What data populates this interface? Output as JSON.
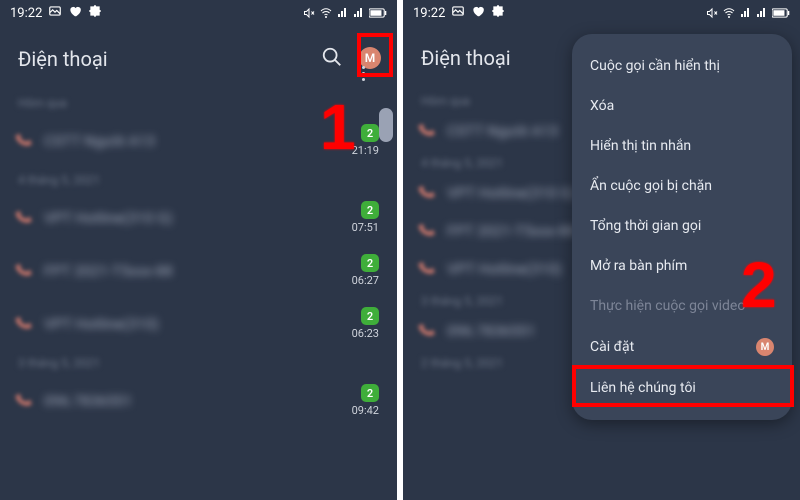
{
  "status": {
    "time": "19:22"
  },
  "header": {
    "title": "Điện thoại"
  },
  "badge_text": "2",
  "avatar_initial": "M",
  "left": {
    "groups": [
      {
        "label": "Hôm qua",
        "rows": [
          {
            "name": "CSTT Người A13",
            "time": "21:19"
          }
        ]
      },
      {
        "label": "4 tháng 5, 2021",
        "rows": [
          {
            "name": "VPT Hotline(310 G)",
            "time": "07:51"
          },
          {
            "name": "FPT 2021-T5xxx-88",
            "time": "06:27"
          },
          {
            "name": "VPT Hotline(310)",
            "time": "06:23"
          }
        ]
      },
      {
        "label": "3 tháng 5, 2021",
        "rows": [
          {
            "name": "096.7836551",
            "time": "09:42"
          }
        ]
      }
    ]
  },
  "right": {
    "groups": [
      {
        "label": "Hôm qua",
        "rows": [
          {
            "name": "CSTT Người A13"
          }
        ]
      },
      {
        "label": "4 tháng 5, 2021",
        "rows": [
          {
            "name": "VPT Hotline(310 G)"
          },
          {
            "name": "FPT 2021-T5xxx-88"
          },
          {
            "name": "VPT Hotline(310)"
          }
        ]
      },
      {
        "label": "3 tháng 5, 2021",
        "rows": [
          {
            "name": "096.7836551"
          }
        ]
      },
      {
        "label": "2 tháng 5, 2021",
        "rows": []
      }
    ]
  },
  "menu": {
    "items": [
      {
        "label": "Cuộc gọi cần hiển thị",
        "disabled": false
      },
      {
        "label": "Xóa",
        "disabled": false
      },
      {
        "label": "Hiển thị tin nhắn",
        "disabled": false
      },
      {
        "label": "Ẩn cuộc gọi bị chặn",
        "disabled": false
      },
      {
        "label": "Tổng thời gian gọi",
        "disabled": false
      },
      {
        "label": "Mở ra bàn phím",
        "disabled": false
      },
      {
        "label": "Thực hiện cuộc gọi video",
        "disabled": true
      },
      {
        "label": "Cài đặt",
        "disabled": false,
        "avatar": true
      },
      {
        "label": "Liên hệ chúng tôi",
        "disabled": false
      }
    ]
  },
  "annotations": {
    "step1": "1",
    "step2": "2"
  }
}
